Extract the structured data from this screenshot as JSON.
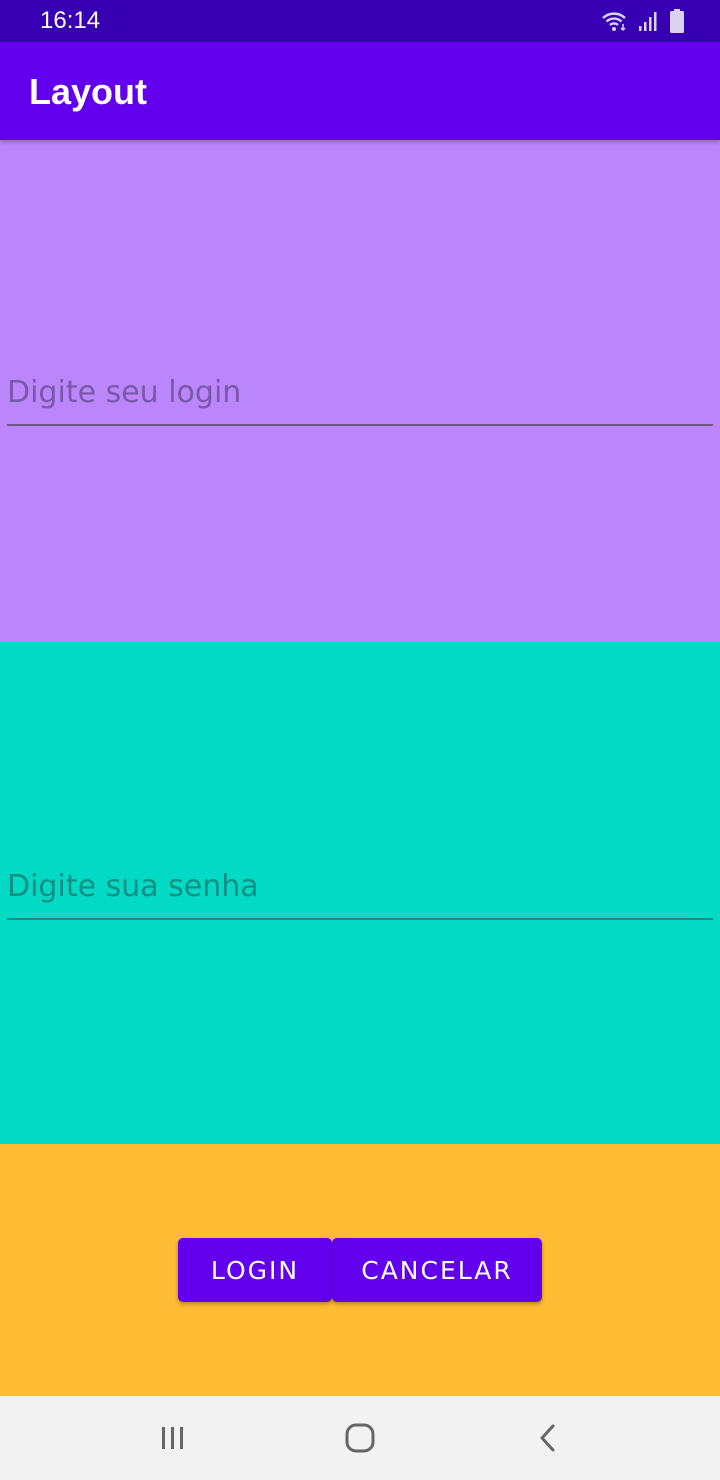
{
  "status_bar": {
    "time": "16:14",
    "icons": [
      "wifi-icon",
      "signal-icon",
      "battery-icon"
    ],
    "background": "#3700B3"
  },
  "app_bar": {
    "title": "Layout",
    "background": "#6200EE"
  },
  "login_section": {
    "background": "#BB86FC",
    "login_field": {
      "placeholder": "Digite seu login",
      "value": ""
    }
  },
  "password_section": {
    "background": "#03DAC5",
    "password_field": {
      "placeholder": "Digite sua senha",
      "value": ""
    }
  },
  "buttons_section": {
    "background": "#FFBB33",
    "login_button": "LOGIN",
    "cancel_button": "CANCELAR"
  },
  "nav_bar": {
    "buttons": [
      "recent-apps-icon",
      "home-icon",
      "back-icon"
    ]
  }
}
